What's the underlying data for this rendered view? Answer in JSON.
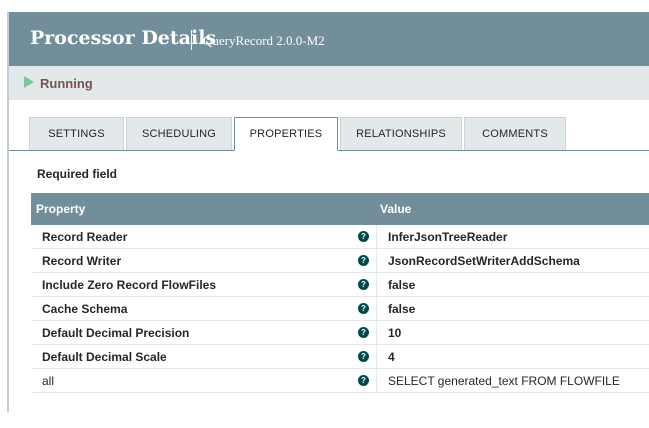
{
  "dialog": {
    "title": "Processor Details",
    "subtitle": "QueryRecord 2.0.0-M2"
  },
  "status": {
    "state": "Running",
    "icon": "play-icon",
    "color": "#7dc7a0"
  },
  "tabs": [
    {
      "label": "SETTINGS",
      "active": false
    },
    {
      "label": "SCHEDULING",
      "active": false
    },
    {
      "label": "PROPERTIES",
      "active": true
    },
    {
      "label": "RELATIONSHIPS",
      "active": false
    },
    {
      "label": "COMMENTS",
      "active": false
    }
  ],
  "required_label": "Required field",
  "table": {
    "headers": {
      "property": "Property",
      "value": "Value"
    },
    "rows": [
      {
        "name": "Record Reader",
        "value": "InferJsonTreeReader",
        "required": true
      },
      {
        "name": "Record Writer",
        "value": "JsonRecordSetWriterAddSchema",
        "required": true
      },
      {
        "name": "Include Zero Record FlowFiles",
        "value": "false",
        "required": true
      },
      {
        "name": "Cache Schema",
        "value": "false",
        "required": true
      },
      {
        "name": "Default Decimal Precision",
        "value": "10",
        "required": true
      },
      {
        "name": "Default Decimal Scale",
        "value": "4",
        "required": true
      },
      {
        "name": "all",
        "value": "SELECT generated_text FROM FLOWFILE",
        "required": false
      }
    ],
    "help_icon": "question-circle-icon",
    "help_glyph": "?"
  },
  "colors": {
    "header": "#728e9b",
    "status_bar": "#e3e8eb",
    "help_icon": "#004849"
  }
}
